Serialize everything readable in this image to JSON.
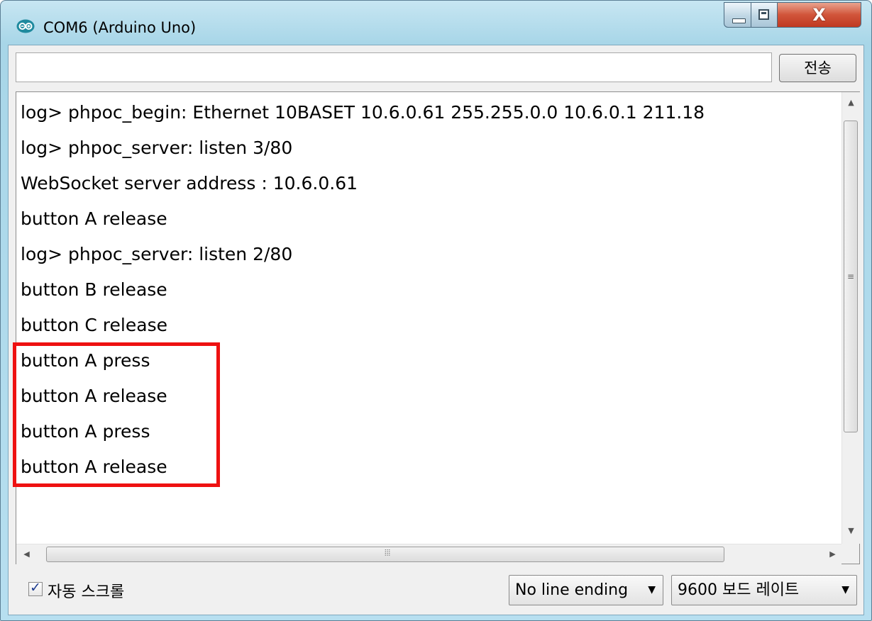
{
  "window": {
    "title": "COM6 (Arduino Uno)",
    "close_glyph": "X"
  },
  "send": {
    "input_value": "",
    "button_label": "전송"
  },
  "log_lines": [
    "log> phpoc_begin: Ethernet 10BASET 10.6.0.61 255.255.0.0 10.6.0.1 211.18",
    "log> phpoc_server: listen 3/80",
    "WebSocket server address : 10.6.0.61",
    "button A release",
    "log> phpoc_server: listen 2/80",
    "button B release",
    "button C release",
    "button A press",
    "button A release",
    "button A press",
    "button A release"
  ],
  "highlight_color": "#ee1111",
  "footer": {
    "autoscroll_checked": true,
    "autoscroll_label": "자동 스크롤",
    "line_ending_selected": "No line ending",
    "baud_selected": "9600 보드 레이트"
  },
  "icons": {
    "app": "arduino-logo-icon",
    "minimize": "minimize-icon",
    "maximize": "maximize-icon",
    "close": "close-icon",
    "dropdown": "chevron-down-icon"
  }
}
